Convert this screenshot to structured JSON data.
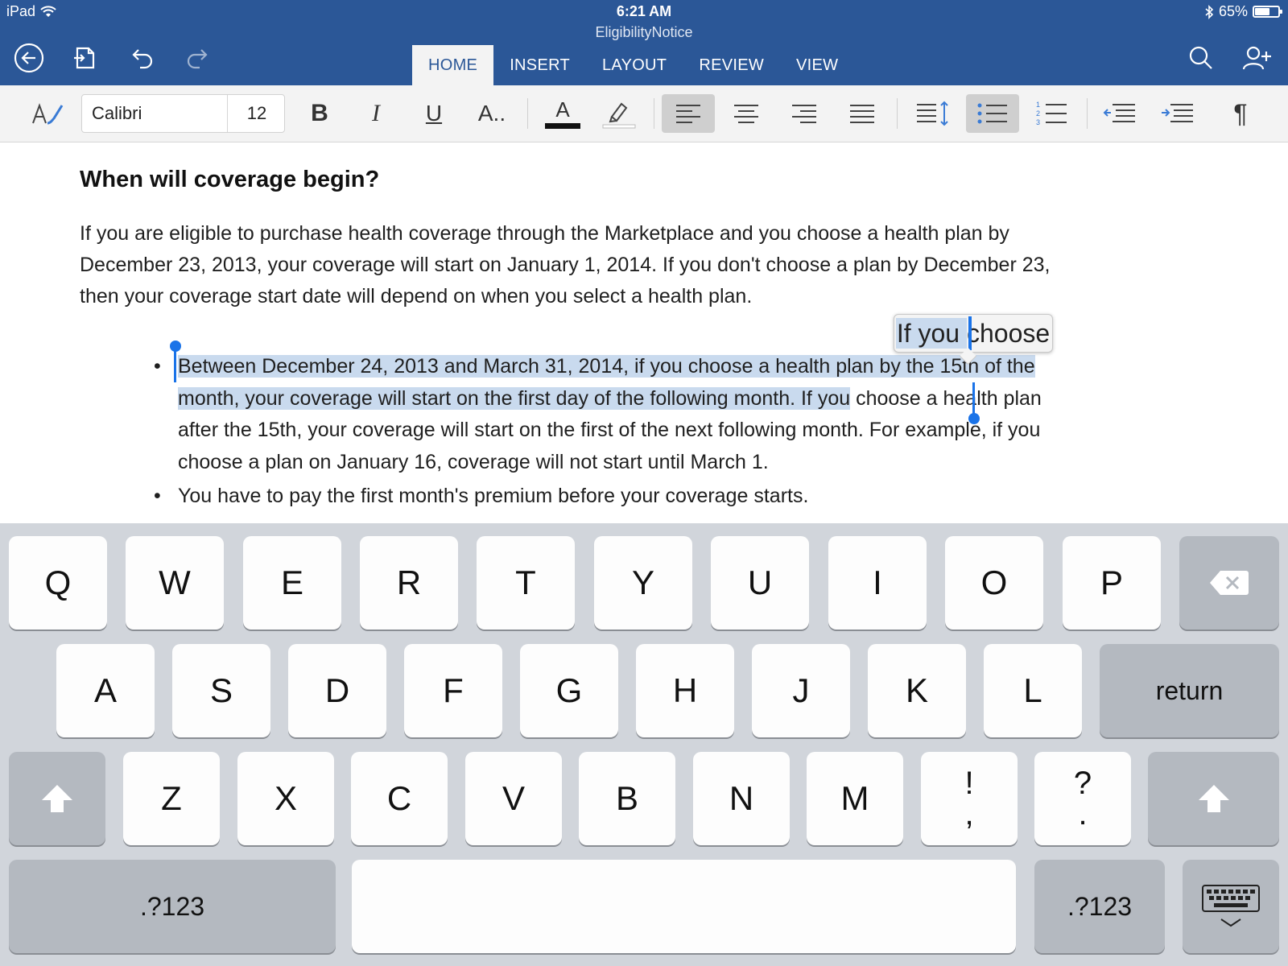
{
  "status": {
    "device": "iPad",
    "time": "6:21 AM",
    "battery": "65%",
    "battery_level": 0.65
  },
  "document_title": "EligibilityNotice",
  "tabs": [
    "HOME",
    "INSERT",
    "LAYOUT",
    "REVIEW",
    "VIEW"
  ],
  "active_tab": "HOME",
  "ribbon": {
    "font_name": "Calibri",
    "font_size": "12",
    "bold_label": "B",
    "italic_label": "I",
    "underline_label": "U",
    "text_effects_label": "A..",
    "font_color_label": "A",
    "font_color": "#111111",
    "pilcrow": "¶"
  },
  "document": {
    "heading": "When will coverage begin?",
    "paragraph_lines": [
      "If you are eligible to purchase health coverage through the Marketplace and you choose a health plan by",
      "December 23, 2013, your coverage will start on January 1, 2014.  If you don't choose a plan by December 23,",
      "then your coverage start date will depend on when you select a health plan."
    ],
    "bullet1": {
      "line1_selected": "Between December 24, 2013 and March 31, 2014, if you choose a health plan by the 15th of the",
      "line2_selected": "month, your coverage will start on the first day of the following month. If you",
      "line2_rest": " choose a health plan",
      "line3": "after the 15th, your coverage will start on the first of the next following month. For example, if you",
      "line4": "choose a plan on January 16, coverage will not start until March 1."
    },
    "bullet2": "You have to pay the first month's premium before your coverage starts.",
    "bullet_char": "•",
    "magnifier_text": "If you choose",
    "selection_color": "#c9daee"
  },
  "keyboard": {
    "row1": [
      "Q",
      "W",
      "E",
      "R",
      "T",
      "Y",
      "U",
      "I",
      "O",
      "P"
    ],
    "row2": [
      "A",
      "S",
      "D",
      "F",
      "G",
      "H",
      "J",
      "K",
      "L"
    ],
    "return_label": "return",
    "row3": [
      "Z",
      "X",
      "C",
      "V",
      "B",
      "N",
      "M"
    ],
    "punct1_top": "!",
    "punct1_bottom": ",",
    "punct2_top": "?",
    "punct2_bottom": ".",
    "numbers_label": ".?123"
  }
}
